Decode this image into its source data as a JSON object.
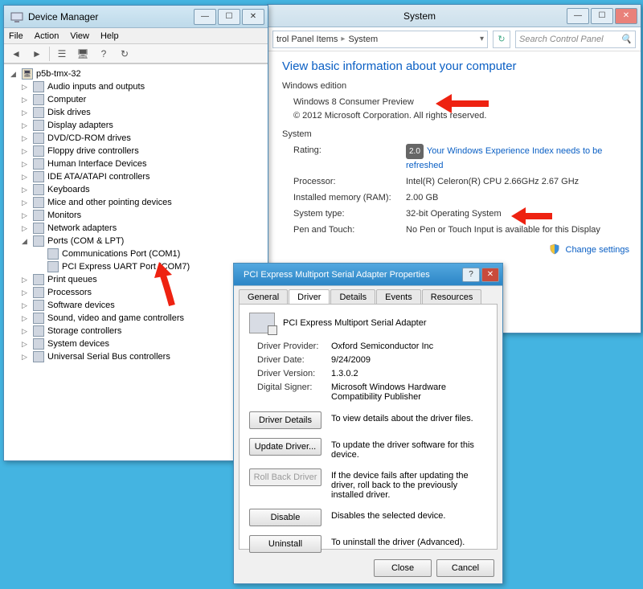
{
  "devmgr": {
    "title": "Device Manager",
    "menu": [
      "File",
      "Action",
      "View",
      "Help"
    ],
    "root": "p5b-tmx-32",
    "nodes": [
      "Audio inputs and outputs",
      "Computer",
      "Disk drives",
      "Display adapters",
      "DVD/CD-ROM drives",
      "Floppy drive controllers",
      "Human Interface Devices",
      "IDE ATA/ATAPI controllers",
      "Keyboards",
      "Mice and other pointing devices",
      "Monitors",
      "Network adapters"
    ],
    "ports_label": "Ports (COM & LPT)",
    "ports_children": [
      "Communications Port (COM1)",
      "PCI Express UART Port (COM7)"
    ],
    "nodes_after": [
      "Print queues",
      "Processors",
      "Software devices",
      "Sound, video and game controllers",
      "Storage controllers",
      "System devices",
      "Universal Serial Bus controllers"
    ]
  },
  "system": {
    "title": "System",
    "breadcrumb": {
      "a": "trol Panel Items",
      "b": "System"
    },
    "search_placeholder": "Search Control Panel",
    "heading": "View basic information about your computer",
    "edition_section": "Windows edition",
    "edition_name": "Windows 8 Consumer Preview",
    "copyright": "© 2012 Microsoft Corporation. All rights reserved.",
    "system_section": "System",
    "rating_label": "Rating:",
    "rating_badge": "2.0",
    "rating_link": "Your Windows Experience Index needs to be refreshed",
    "processor_label": "Processor:",
    "processor_value": "Intel(R) Celeron(R) CPU 2.66GHz   2.67 GHz",
    "ram_label": "Installed memory (RAM):",
    "ram_value": "2.00 GB",
    "systype_label": "System type:",
    "systype_value": "32-bit Operating System",
    "pentouch_label": "Pen and Touch:",
    "pentouch_value": "No Pen or Touch Input is available for this Display",
    "change_settings": "Change settings"
  },
  "propdlg": {
    "title": "PCI Express Multiport Serial Adapter Properties",
    "tabs": [
      "General",
      "Driver",
      "Details",
      "Events",
      "Resources"
    ],
    "active_tab": 1,
    "device_name": "PCI Express Multiport Serial Adapter",
    "provider_label": "Driver Provider:",
    "provider_value": "Oxford Semiconductor Inc",
    "date_label": "Driver Date:",
    "date_value": "9/24/2009",
    "version_label": "Driver Version:",
    "version_value": "1.3.0.2",
    "signer_label": "Digital Signer:",
    "signer_value": "Microsoft Windows Hardware Compatibility Publisher",
    "buttons": {
      "details": {
        "label": "Driver Details",
        "desc": "To view details about the driver files."
      },
      "update": {
        "label": "Update Driver...",
        "desc": "To update the driver software for this device."
      },
      "rollback": {
        "label": "Roll Back Driver",
        "desc": "If the device fails after updating the driver, roll back to the previously installed driver."
      },
      "disable": {
        "label": "Disable",
        "desc": "Disables the selected device."
      },
      "uninstall": {
        "label": "Uninstall",
        "desc": "To uninstall the driver (Advanced)."
      }
    },
    "close": "Close",
    "cancel": "Cancel"
  }
}
